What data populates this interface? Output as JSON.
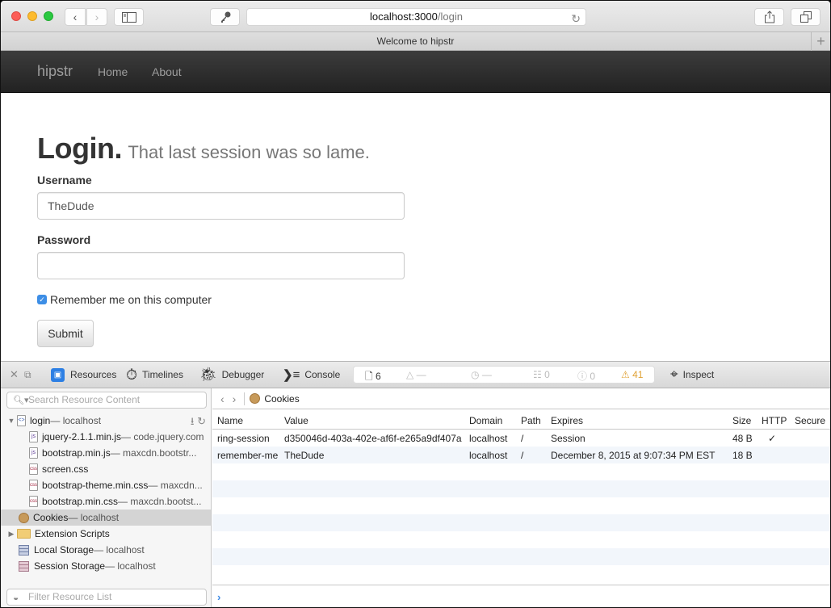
{
  "browser": {
    "address_host": "localhost:3000",
    "address_path": "/login",
    "tab_title": "Welcome to hipstr",
    "icons": {
      "back": "chevron-left-icon",
      "forward": "chevron-right-icon",
      "sidebar": "sidebar-icon",
      "key": "key-icon",
      "reload": "reload-icon",
      "share": "share-icon",
      "tabs": "tabs-overview-icon",
      "new_tab": "plus-icon"
    }
  },
  "navbar": {
    "brand": "hipstr",
    "links": [
      "Home",
      "About"
    ]
  },
  "page": {
    "title": "Login.",
    "subtitle": "That last session was so lame.",
    "username_label": "Username",
    "username_value": "TheDude",
    "password_label": "Password",
    "password_value": "",
    "remember_label": "Remember me on this computer",
    "remember_checked": true,
    "submit_label": "Submit"
  },
  "devtools": {
    "tabs": [
      {
        "label": "Resources",
        "icon": "resources-icon"
      },
      {
        "label": "Timelines",
        "icon": "stopwatch-icon"
      },
      {
        "label": "Debugger",
        "icon": "bug-icon"
      },
      {
        "label": "Console",
        "icon": "console-icon"
      }
    ],
    "status": {
      "resources": "6",
      "load": "—",
      "time": "—",
      "logs": "0",
      "errors": "0",
      "warnings": "41",
      "warning_color": "#e0a235"
    },
    "inspect_label": "Inspect",
    "sidebar": {
      "search_placeholder": "Search Resource Content",
      "filter_placeholder": "Filter Resource List",
      "tree": [
        {
          "name": "login",
          "sub": " — localhost",
          "type": "html",
          "expanded": true
        },
        {
          "name": "jquery-2.1.1.min.js",
          "sub": " — code.jquery.com",
          "type": "js"
        },
        {
          "name": "bootstrap.min.js",
          "sub": " — maxcdn.bootstr...",
          "type": "js"
        },
        {
          "name": "screen.css",
          "sub": "",
          "type": "css"
        },
        {
          "name": "bootstrap-theme.min.css",
          "sub": " — maxcdn...",
          "type": "css"
        },
        {
          "name": "bootstrap.min.css",
          "sub": " — maxcdn.bootst...",
          "type": "css"
        },
        {
          "name": "Cookies",
          "sub": " — localhost",
          "type": "cookie",
          "selected": true
        },
        {
          "name": "Extension Scripts",
          "sub": "",
          "type": "folder"
        },
        {
          "name": "Local Storage",
          "sub": " — localhost",
          "type": "local-storage"
        },
        {
          "name": "Session Storage",
          "sub": " — localhost",
          "type": "session-storage"
        }
      ]
    },
    "breadcrumb": "Cookies",
    "cookies": {
      "columns": [
        "Name",
        "Value",
        "Domain",
        "Path",
        "Expires",
        "Size",
        "HTTP",
        "Secure"
      ],
      "rows": [
        {
          "name": "ring-session",
          "value": "d350046d-403a-402e-af6f-e265a9df407a",
          "domain": "localhost",
          "path": "/",
          "expires": "Session",
          "size": "48 B",
          "http": "✓",
          "secure": ""
        },
        {
          "name": "remember-me",
          "value": "TheDude",
          "domain": "localhost",
          "path": "/",
          "expires": "December 8, 2015 at 9:07:34 PM EST",
          "size": "18 B",
          "http": "",
          "secure": ""
        }
      ]
    },
    "console_prompt": "›"
  }
}
